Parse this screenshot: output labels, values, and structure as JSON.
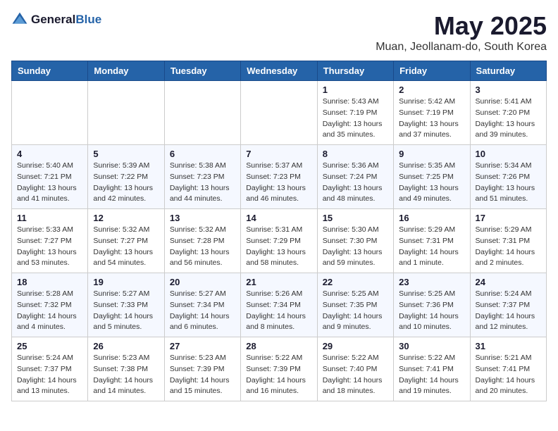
{
  "header": {
    "logo_general": "General",
    "logo_blue": "Blue",
    "title": "May 2025",
    "subtitle": "Muan, Jeollanam-do, South Korea"
  },
  "weekdays": [
    "Sunday",
    "Monday",
    "Tuesday",
    "Wednesday",
    "Thursday",
    "Friday",
    "Saturday"
  ],
  "weeks": [
    [
      {
        "day": "",
        "info": ""
      },
      {
        "day": "",
        "info": ""
      },
      {
        "day": "",
        "info": ""
      },
      {
        "day": "",
        "info": ""
      },
      {
        "day": "1",
        "info": "Sunrise: 5:43 AM\nSunset: 7:19 PM\nDaylight: 13 hours\nand 35 minutes."
      },
      {
        "day": "2",
        "info": "Sunrise: 5:42 AM\nSunset: 7:19 PM\nDaylight: 13 hours\nand 37 minutes."
      },
      {
        "day": "3",
        "info": "Sunrise: 5:41 AM\nSunset: 7:20 PM\nDaylight: 13 hours\nand 39 minutes."
      }
    ],
    [
      {
        "day": "4",
        "info": "Sunrise: 5:40 AM\nSunset: 7:21 PM\nDaylight: 13 hours\nand 41 minutes."
      },
      {
        "day": "5",
        "info": "Sunrise: 5:39 AM\nSunset: 7:22 PM\nDaylight: 13 hours\nand 42 minutes."
      },
      {
        "day": "6",
        "info": "Sunrise: 5:38 AM\nSunset: 7:23 PM\nDaylight: 13 hours\nand 44 minutes."
      },
      {
        "day": "7",
        "info": "Sunrise: 5:37 AM\nSunset: 7:23 PM\nDaylight: 13 hours\nand 46 minutes."
      },
      {
        "day": "8",
        "info": "Sunrise: 5:36 AM\nSunset: 7:24 PM\nDaylight: 13 hours\nand 48 minutes."
      },
      {
        "day": "9",
        "info": "Sunrise: 5:35 AM\nSunset: 7:25 PM\nDaylight: 13 hours\nand 49 minutes."
      },
      {
        "day": "10",
        "info": "Sunrise: 5:34 AM\nSunset: 7:26 PM\nDaylight: 13 hours\nand 51 minutes."
      }
    ],
    [
      {
        "day": "11",
        "info": "Sunrise: 5:33 AM\nSunset: 7:27 PM\nDaylight: 13 hours\nand 53 minutes."
      },
      {
        "day": "12",
        "info": "Sunrise: 5:32 AM\nSunset: 7:27 PM\nDaylight: 13 hours\nand 54 minutes."
      },
      {
        "day": "13",
        "info": "Sunrise: 5:32 AM\nSunset: 7:28 PM\nDaylight: 13 hours\nand 56 minutes."
      },
      {
        "day": "14",
        "info": "Sunrise: 5:31 AM\nSunset: 7:29 PM\nDaylight: 13 hours\nand 58 minutes."
      },
      {
        "day": "15",
        "info": "Sunrise: 5:30 AM\nSunset: 7:30 PM\nDaylight: 13 hours\nand 59 minutes."
      },
      {
        "day": "16",
        "info": "Sunrise: 5:29 AM\nSunset: 7:31 PM\nDaylight: 14 hours\nand 1 minute."
      },
      {
        "day": "17",
        "info": "Sunrise: 5:29 AM\nSunset: 7:31 PM\nDaylight: 14 hours\nand 2 minutes."
      }
    ],
    [
      {
        "day": "18",
        "info": "Sunrise: 5:28 AM\nSunset: 7:32 PM\nDaylight: 14 hours\nand 4 minutes."
      },
      {
        "day": "19",
        "info": "Sunrise: 5:27 AM\nSunset: 7:33 PM\nDaylight: 14 hours\nand 5 minutes."
      },
      {
        "day": "20",
        "info": "Sunrise: 5:27 AM\nSunset: 7:34 PM\nDaylight: 14 hours\nand 6 minutes."
      },
      {
        "day": "21",
        "info": "Sunrise: 5:26 AM\nSunset: 7:34 PM\nDaylight: 14 hours\nand 8 minutes."
      },
      {
        "day": "22",
        "info": "Sunrise: 5:25 AM\nSunset: 7:35 PM\nDaylight: 14 hours\nand 9 minutes."
      },
      {
        "day": "23",
        "info": "Sunrise: 5:25 AM\nSunset: 7:36 PM\nDaylight: 14 hours\nand 10 minutes."
      },
      {
        "day": "24",
        "info": "Sunrise: 5:24 AM\nSunset: 7:37 PM\nDaylight: 14 hours\nand 12 minutes."
      }
    ],
    [
      {
        "day": "25",
        "info": "Sunrise: 5:24 AM\nSunset: 7:37 PM\nDaylight: 14 hours\nand 13 minutes."
      },
      {
        "day": "26",
        "info": "Sunrise: 5:23 AM\nSunset: 7:38 PM\nDaylight: 14 hours\nand 14 minutes."
      },
      {
        "day": "27",
        "info": "Sunrise: 5:23 AM\nSunset: 7:39 PM\nDaylight: 14 hours\nand 15 minutes."
      },
      {
        "day": "28",
        "info": "Sunrise: 5:22 AM\nSunset: 7:39 PM\nDaylight: 14 hours\nand 16 minutes."
      },
      {
        "day": "29",
        "info": "Sunrise: 5:22 AM\nSunset: 7:40 PM\nDaylight: 14 hours\nand 18 minutes."
      },
      {
        "day": "30",
        "info": "Sunrise: 5:22 AM\nSunset: 7:41 PM\nDaylight: 14 hours\nand 19 minutes."
      },
      {
        "day": "31",
        "info": "Sunrise: 5:21 AM\nSunset: 7:41 PM\nDaylight: 14 hours\nand 20 minutes."
      }
    ]
  ]
}
